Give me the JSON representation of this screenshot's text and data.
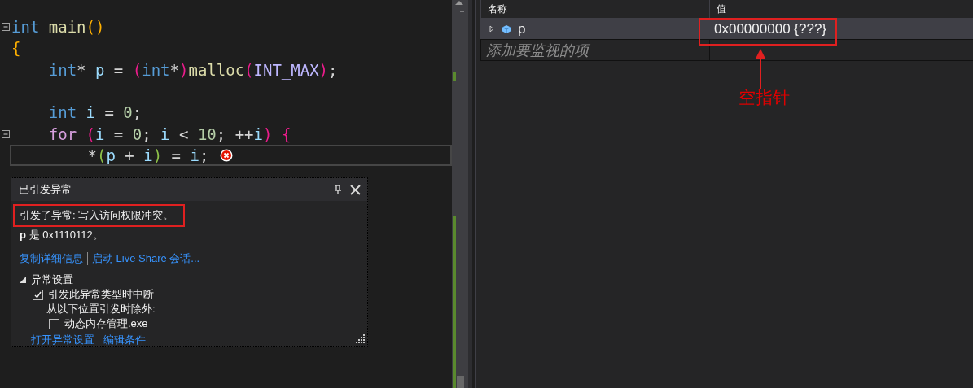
{
  "editor": {
    "lines": [
      {
        "fold": true,
        "current": false,
        "error": false,
        "tokens": [
          {
            "text": "int",
            "kind": "keyword"
          },
          {
            "text": " main",
            "kind": "function"
          },
          {
            "text": "()",
            "kind": "brace1"
          }
        ]
      },
      {
        "fold": false,
        "current": false,
        "error": false,
        "tokens": [
          {
            "text": "{",
            "kind": "brace1"
          }
        ],
        "children": [
          {
            "fold": false,
            "current": false,
            "error": false,
            "tokens": [
              {
                "text": "int",
                "kind": "keyword"
              },
              {
                "text": "* ",
                "kind": "plain"
              },
              {
                "text": "p",
                "kind": "variable"
              },
              {
                "text": " = ",
                "kind": "plain"
              },
              {
                "text": "(",
                "kind": "brace2"
              },
              {
                "text": "int",
                "kind": "keyword"
              },
              {
                "text": "*",
                "kind": "plain"
              },
              {
                "text": ")",
                "kind": "brace2"
              },
              {
                "text": "malloc",
                "kind": "function"
              },
              {
                "text": "(",
                "kind": "brace2"
              },
              {
                "text": "INT_MAX",
                "kind": "macro"
              },
              {
                "text": ")",
                "kind": "brace2"
              },
              {
                "text": ";",
                "kind": "plain"
              }
            ]
          },
          {
            "fold": false,
            "current": false,
            "error": false
          },
          {
            "fold": false,
            "current": false,
            "error": false,
            "tokens": [
              {
                "text": "int",
                "kind": "keyword"
              },
              {
                "text": " i",
                "kind": "variable"
              },
              {
                "text": " = ",
                "kind": "plain"
              },
              {
                "text": "0",
                "kind": "number"
              },
              {
                "text": ";",
                "kind": "plain"
              }
            ]
          },
          {
            "fold": true,
            "current": false,
            "error": false,
            "tokens": [
              {
                "text": "for",
                "kind": "control"
              },
              {
                "text": " (",
                "kind": "brace2"
              },
              {
                "text": "i",
                "kind": "variable"
              },
              {
                "text": " = ",
                "kind": "plain"
              },
              {
                "text": "0",
                "kind": "number"
              },
              {
                "text": "; ",
                "kind": "plain"
              },
              {
                "text": "i",
                "kind": "variable"
              },
              {
                "text": " < ",
                "kind": "plain"
              },
              {
                "text": "10",
                "kind": "number"
              },
              {
                "text": "; ++",
                "kind": "plain"
              },
              {
                "text": "i",
                "kind": "variable"
              },
              {
                "text": ")",
                "kind": "brace2"
              },
              {
                "text": " {",
                "kind": "brace2"
              }
            ],
            "children": [
              {
                "fold": false,
                "current": true,
                "error": true,
                "tokens": [
                  {
                    "text": "*",
                    "kind": "plain"
                  },
                  {
                    "text": "(",
                    "kind": "brace3"
                  },
                  {
                    "text": "p",
                    "kind": "variable"
                  },
                  {
                    "text": " + ",
                    "kind": "plain"
                  },
                  {
                    "text": "i",
                    "kind": "variable"
                  },
                  {
                    "text": ")",
                    "kind": "brace3"
                  },
                  {
                    "text": " = ",
                    "kind": "plain"
                  },
                  {
                    "text": "i",
                    "kind": "variable"
                  },
                  {
                    "text": ";",
                    "kind": "plain"
                  }
                ]
              }
            ]
          }
        ]
      }
    ]
  },
  "exception_popup": {
    "title": "已引发异常",
    "message": "引发了异常: 写入访问权限冲突。",
    "detail": "**p** 是 0x1110112。",
    "links": [
      "复制详细信息",
      "启动 Live Share 会话..."
    ],
    "settings": {
      "title": "异常设置",
      "expanded": true,
      "items": [
        {
          "kind": "checkbox",
          "label": "引发此异常类型时中断",
          "checked": true
        },
        {
          "kind": "group",
          "label": "从以下位置引发时除外:",
          "children": [
            {
              "kind": "checkbox",
              "label": "动态内存管理.exe",
              "checked": false
            }
          ]
        }
      ]
    },
    "footer_links": [
      "打开异常设置",
      "编辑条件"
    ]
  },
  "watch": {
    "columns": [
      "名称",
      "值"
    ],
    "rows": [
      {
        "name": "p",
        "value": "0x00000000 {???}",
        "expanded": false,
        "selected": true
      }
    ],
    "placeholder": "添加要监视的项"
  },
  "annotation": {
    "label": "空指针"
  }
}
